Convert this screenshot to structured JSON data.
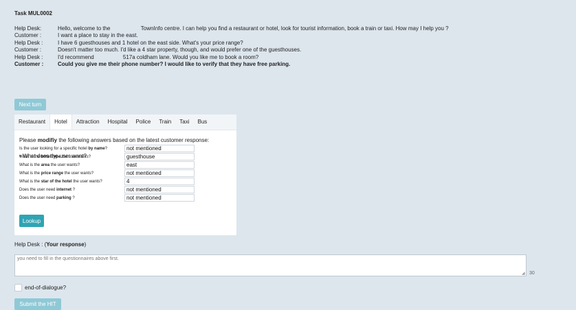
{
  "task": {
    "title": "Task MUL0002"
  },
  "dialog": [
    {
      "speaker": "Help Desk:",
      "text": "Hello, welcome to the                    TownInfo centre. I can help you find a restaurant or hotel, look for tourist information, book a train or taxi. How may I help you ?",
      "bold": false
    },
    {
      "speaker": "Customer :",
      "text": "I want a place to stay in the east.",
      "bold": false
    },
    {
      "speaker": "Help Desk :",
      "text": "I have 6 guesthouses and 1 hotel on the east side. What's your price range?",
      "bold": false
    },
    {
      "speaker": "Customer :",
      "text": "Doesn't matter too much. I'd like a 4 star property, though, and would prefer one of the guesthouses.",
      "bold": false
    },
    {
      "speaker": "Help Desk :",
      "text": "I'd recommend                   517a coldham lane. Would you like me to book a room?",
      "bold": false
    },
    {
      "speaker": "Customer :",
      "text": "Could you give me their phone number? I would like to verify that they have free parking.",
      "bold": true
    }
  ],
  "buttons": {
    "next_turn": "Next turn",
    "lookup": "Lookup",
    "submit": "Submit the HIT"
  },
  "tabs": [
    "Restaurant",
    "Hotel",
    "Attraction",
    "Hospital",
    "Police",
    "Train",
    "Taxi",
    "Bus"
  ],
  "active_tab": "Hotel",
  "instruction": {
    "pre": "Please ",
    "bold": "modifiy",
    "post": " the following answers based on the latest customer response:"
  },
  "section_title": "• What does the user want?",
  "questions": [
    {
      "pre": "Is the user looking for a specific hotel ",
      "bold": "by name",
      "post": "?",
      "value": "not mentioned"
    },
    {
      "pre": "What is the ",
      "bold": "hotel type",
      "post": " the user wants?",
      "value": "guesthouse"
    },
    {
      "pre": "What is the ",
      "bold": "area",
      "post": " the user wants?",
      "value": "east"
    },
    {
      "pre": "What is the ",
      "bold": "price range",
      "post": " the user wants?",
      "value": "not mentioned"
    },
    {
      "pre": "What is the ",
      "bold": "star of the hotel",
      "post": " the user wants?",
      "value": "4"
    },
    {
      "pre": "Does the user need ",
      "bold": "internet",
      "post": " ?",
      "value": "not mentioned"
    },
    {
      "pre": "Does the user need ",
      "bold": "parking",
      "post": " ?",
      "value": "not mentioned"
    }
  ],
  "response": {
    "label_pre": "Help Desk : (",
    "label_bold": "Your response",
    "label_post": ")",
    "placeholder": "you need to fill in the questionnaires above first.",
    "char_count": "30"
  },
  "end_of_dialogue": {
    "label": "end-of-dialogue?",
    "checked": false
  },
  "colors": {
    "background": "#dde6ed",
    "primary_button": "#2fa4b4",
    "disabled_button": "#8fc9d6"
  }
}
